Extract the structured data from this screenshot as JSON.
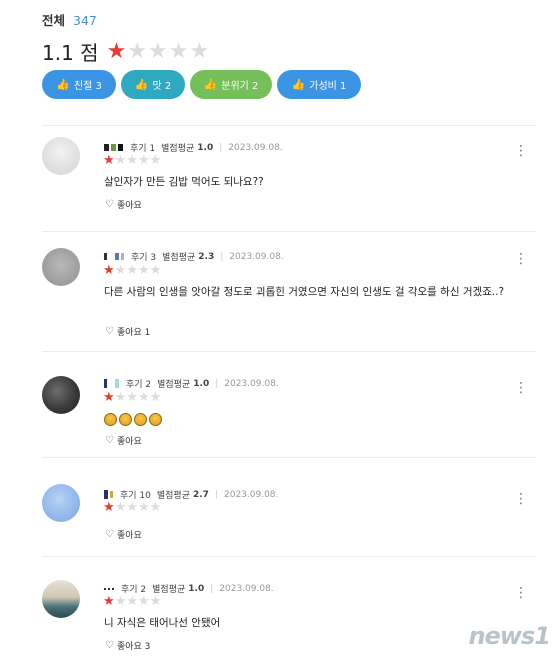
{
  "summary": {
    "total_label": "전체",
    "total_count": "347",
    "score": "1.1 점",
    "rating": 1,
    "rating_max": 5
  },
  "chips": [
    {
      "label": "친절 3",
      "color": "#3b95e4"
    },
    {
      "label": "맛 2",
      "color": "#2fa9bf"
    },
    {
      "label": "분위기 2",
      "color": "#75bf5a"
    },
    {
      "label": "가성비 1",
      "color": "#3b95e4"
    }
  ],
  "reviews": [
    {
      "reviews_count": "후기 1",
      "avg_label": "별점평균",
      "avg": "1.0",
      "date": "2023.09.08.",
      "rating": 1,
      "text": "살인자가 만든 김밥 먹어도 되나요??",
      "like": "좋아요"
    },
    {
      "reviews_count": "후기 3",
      "avg_label": "별점평균",
      "avg": "2.3",
      "date": "2023.09.08.",
      "rating": 1,
      "text": "다른 사람의 인생을 앗아갈 정도로 괴롭힌 거였으면 자신의 인생도 걸 각오를 하신 거겠죠..?",
      "like": "좋아요 1"
    },
    {
      "reviews_count": "후기 2",
      "avg_label": "별점평균",
      "avg": "1.0",
      "date": "2023.09.08.",
      "rating": 1,
      "text": "",
      "like": "좋아요"
    },
    {
      "reviews_count": "후기 10",
      "avg_label": "별점평균",
      "avg": "2.7",
      "date": "2023.09.08.",
      "rating": 1,
      "text": "",
      "like": "좋아요"
    },
    {
      "reviews_count": "후기 2",
      "avg_label": "별점평균",
      "avg": "1.0",
      "date": "2023.09.08.",
      "rating": 1,
      "text": "니 자식은 태어나선 안됐어",
      "like": "좋아요 3"
    }
  ],
  "watermark": "news1"
}
